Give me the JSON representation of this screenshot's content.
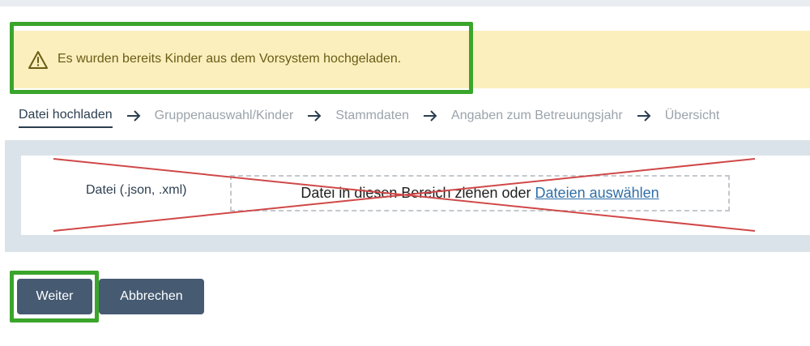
{
  "alert": {
    "icon": "warning-icon",
    "text": "Es wurden bereits Kinder aus dem Vorsystem hochgeladen."
  },
  "steps": [
    {
      "label": "Datei hochladen",
      "active": true
    },
    {
      "label": "Gruppenauswahl/Kinder",
      "active": false
    },
    {
      "label": "Stammdaten",
      "active": false
    },
    {
      "label": "Angaben zum Betreuungsjahr",
      "active": false
    },
    {
      "label": "Übersicht",
      "active": false
    }
  ],
  "upload": {
    "file_label": "Datei (.json, .xml)",
    "dropzone_text": "Datei in diesen Bereich ziehen oder",
    "dropzone_link": "Dateien auswählen"
  },
  "buttons": {
    "next": "Weiter",
    "cancel": "Abbrechen"
  },
  "colors": {
    "highlight": "#3aa52b",
    "cross": "#d04848",
    "button": "#465a72",
    "alert_bg": "#fbefbd"
  }
}
